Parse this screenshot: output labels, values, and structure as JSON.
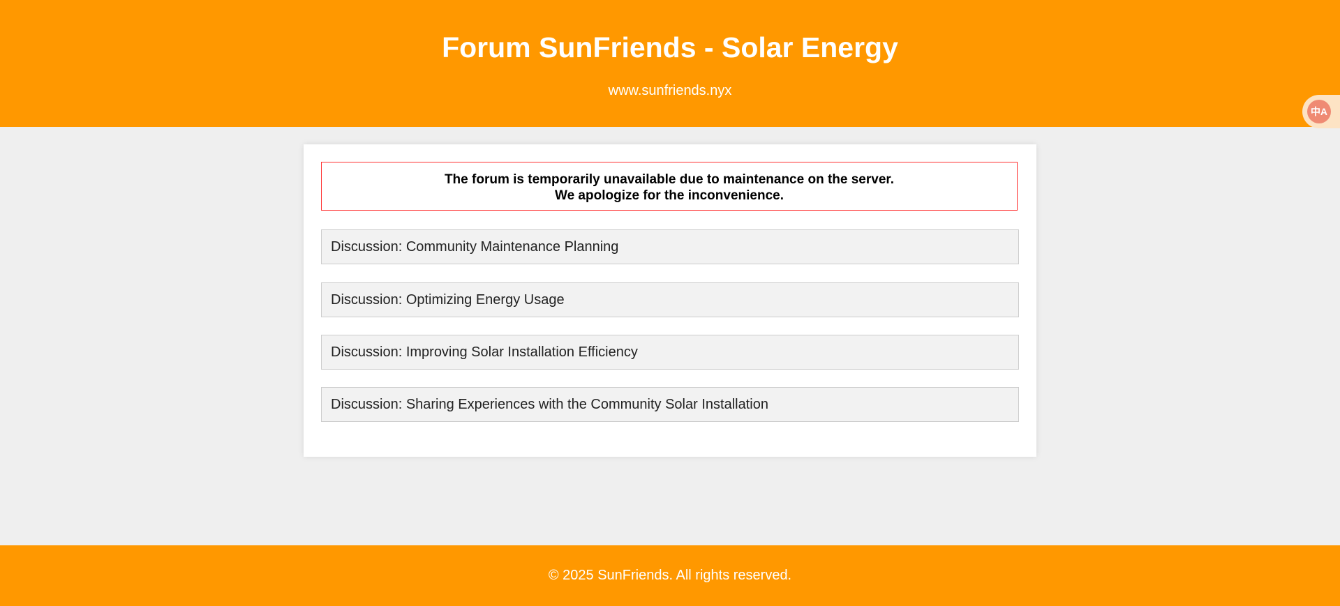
{
  "header": {
    "title": "Forum SunFriends - Solar Energy",
    "url": "www.sunfriends.nyx"
  },
  "translate_widget": {
    "icon": "translate-icon",
    "glyph": "中A"
  },
  "notice": {
    "line1": "The forum is temporarily unavailable due to maintenance on the server.",
    "line2": "We apologize for the inconvenience."
  },
  "discussions": [
    {
      "label": "Discussion: Community Maintenance Planning"
    },
    {
      "label": "Discussion: Optimizing Energy Usage"
    },
    {
      "label": "Discussion: Improving Solar Installation Efficiency"
    },
    {
      "label": "Discussion: Sharing Experiences with the Community Solar Installation"
    }
  ],
  "footer": {
    "text": "© 2025 SunFriends. All rights reserved."
  },
  "colors": {
    "brand": "#ff9800",
    "background": "#efefef",
    "notice_border": "#ff2e2e"
  }
}
